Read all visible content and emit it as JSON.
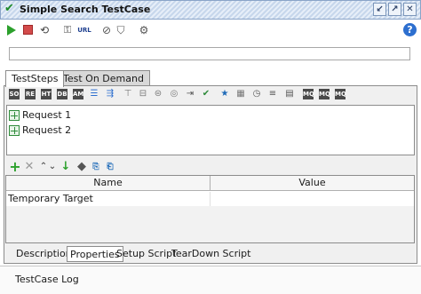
{
  "window": {
    "title": "Simple Search TestCase",
    "controls": [
      "minimize-icon",
      "maximize-icon",
      "close-icon"
    ]
  },
  "toolbar": {
    "icons": [
      "play-icon",
      "stop-icon",
      "loop-icon",
      "key-icon",
      "url-icon",
      "stop-circle-icon",
      "shield-icon",
      "gear-icon",
      "help-icon"
    ],
    "url_label": "URL"
  },
  "search": {
    "value": "",
    "placeholder": ""
  },
  "tabs": [
    {
      "label": "TestSteps",
      "active": true
    },
    {
      "label": "Test On Demand",
      "active": false
    }
  ],
  "steps": [
    {
      "label": "Request 1"
    },
    {
      "label": "Request 2"
    }
  ],
  "properties_table": {
    "columns": [
      "Name",
      "Value"
    ],
    "rows": [
      {
        "name": "Temporary Target",
        "value": ""
      }
    ]
  },
  "bottom_tabs": [
    {
      "label": "Description",
      "active": false
    },
    {
      "label": "Properties",
      "active": true
    },
    {
      "label": "Setup Script",
      "active": false
    },
    {
      "label": "TearDown Script",
      "active": false
    }
  ],
  "log": {
    "label": "TestCase Log"
  },
  "colors": {
    "accent_green": "#2ca02c",
    "stop_red": "#d34b4b",
    "help_blue": "#2d6fcf",
    "title_stripe": "#c7d7ec"
  }
}
